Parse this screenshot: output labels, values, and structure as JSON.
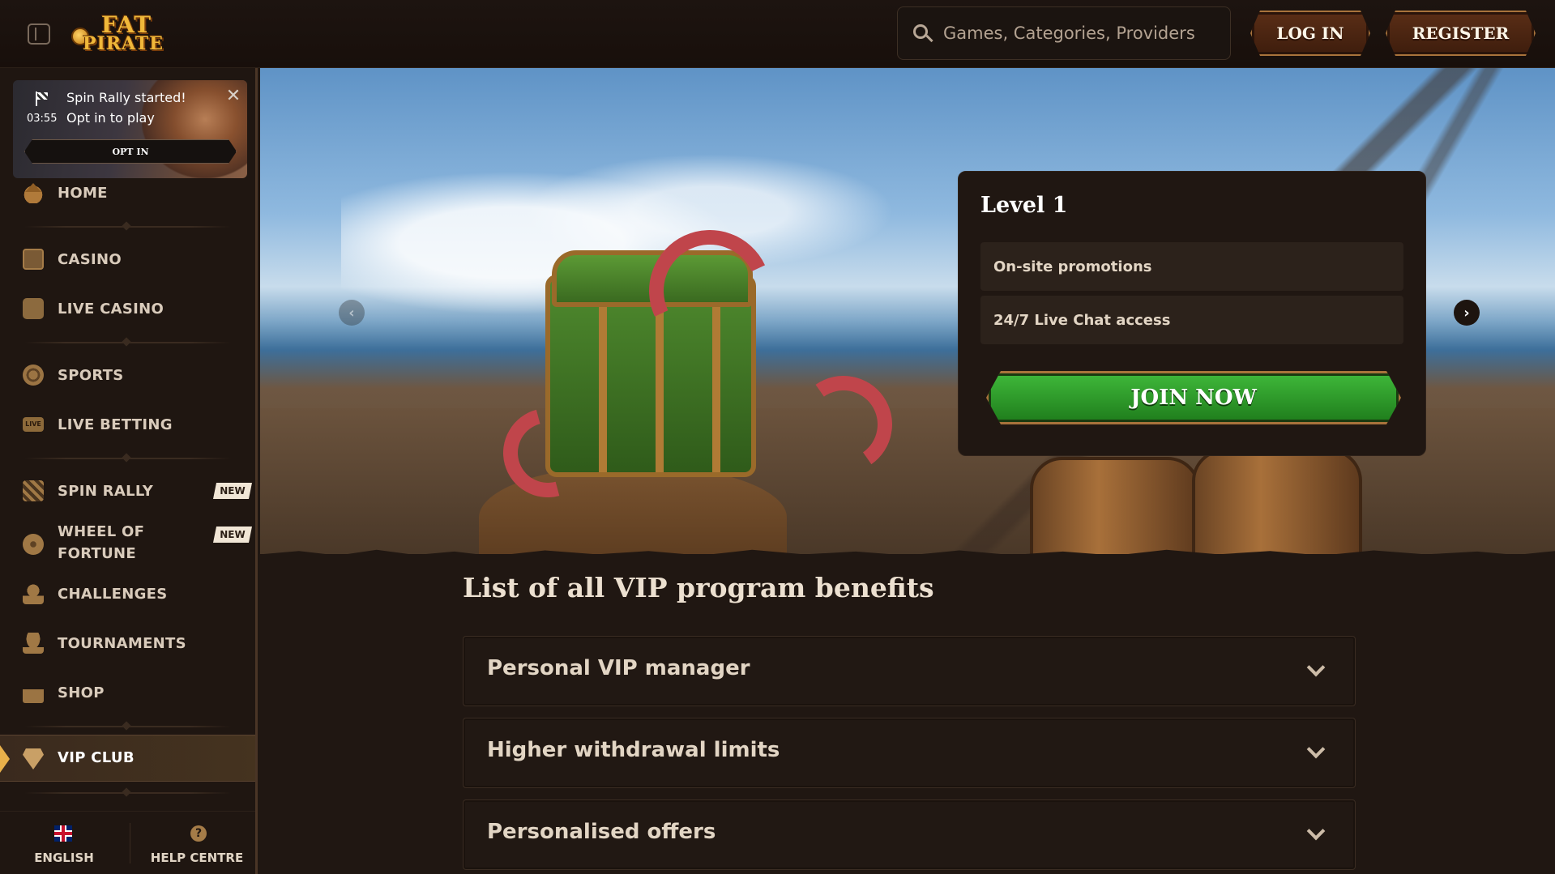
{
  "header": {
    "logo_line1": "FAT",
    "logo_line2": "PIRATE",
    "search_placeholder": "Games, Categories, Providers",
    "login_label": "LOG IN",
    "register_label": "REGISTER"
  },
  "promo": {
    "title": "Spin Rally started!",
    "subtitle": "Opt in to play",
    "timer": "03:55",
    "close": "✕",
    "optin_label": "OPT IN"
  },
  "sidebar": {
    "items": [
      {
        "label": "HOME",
        "icon": "home-icon"
      },
      {
        "label": "CASINO",
        "icon": "casino-icon"
      },
      {
        "label": "LIVE CASINO",
        "icon": "live-casino-icon"
      },
      {
        "label": "SPORTS",
        "icon": "soccer-ball-icon"
      },
      {
        "label": "LIVE BETTING",
        "icon": "live-betting-icon",
        "icon_text": "LIVE"
      },
      {
        "label": "SPIN RALLY",
        "icon": "checkered-flag-icon",
        "badge": "NEW"
      },
      {
        "label": "WHEEL OF FORTUNE",
        "icon": "wheel-icon",
        "badge": "NEW"
      },
      {
        "label": "CHALLENGES",
        "icon": "medal-icon"
      },
      {
        "label": "TOURNAMENTS",
        "icon": "trophy-icon"
      },
      {
        "label": "SHOP",
        "icon": "shopping-bag-icon"
      },
      {
        "label": "VIP CLUB",
        "icon": "diamond-icon",
        "active": true
      }
    ],
    "wheel_line1": "WHEEL OF",
    "wheel_line2": "FORTUNE",
    "footer": {
      "language_label": "ENGLISH",
      "help_label": "HELP CENTRE",
      "help_icon_glyph": "?"
    }
  },
  "hero": {
    "level_title": "Level 1",
    "benefits": [
      "On-site promotions",
      "24/7 Live Chat access"
    ],
    "join_label": "JOIN NOW",
    "prev_glyph": "‹",
    "next_glyph": "›"
  },
  "benefits_section": {
    "title": "List of all VIP program benefits",
    "items": [
      "Personal VIP manager",
      "Higher withdrawal limits",
      "Personalised offers"
    ]
  },
  "colors": {
    "background": "#201712",
    "accent_gold": "#e8b04a",
    "join_green": "#2f9a2a",
    "wood_button": "#5a2e16"
  }
}
